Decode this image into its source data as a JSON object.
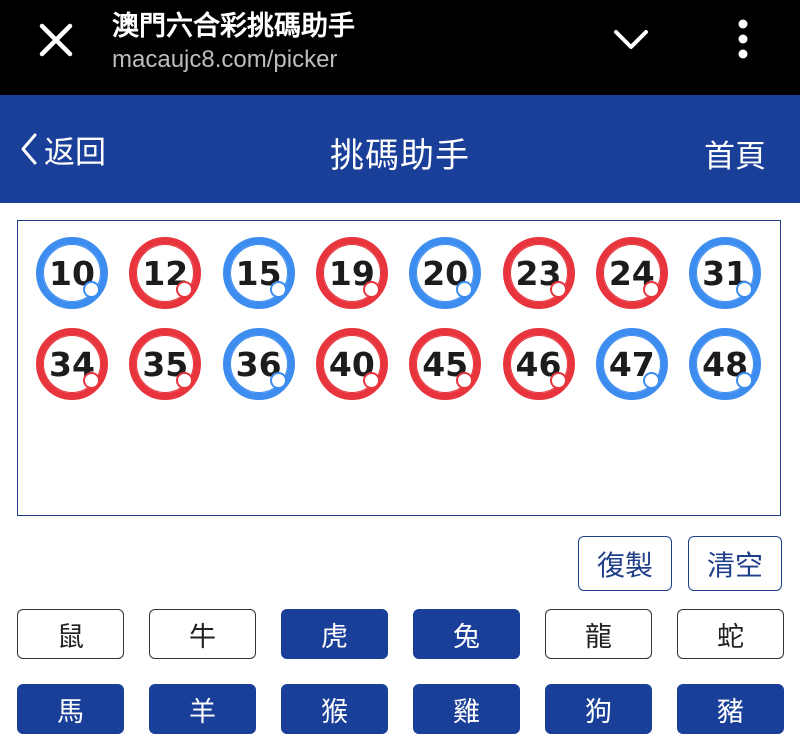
{
  "browser": {
    "title": "澳門六合彩挑碼助手",
    "url": "macaujc8.com/picker"
  },
  "header": {
    "back_label": "返回",
    "title": "挑碼助手",
    "home_label": "首頁"
  },
  "balls": [
    {
      "number": "10",
      "color": "blue"
    },
    {
      "number": "12",
      "color": "red"
    },
    {
      "number": "15",
      "color": "blue"
    },
    {
      "number": "19",
      "color": "red"
    },
    {
      "number": "20",
      "color": "blue"
    },
    {
      "number": "23",
      "color": "red"
    },
    {
      "number": "24",
      "color": "red"
    },
    {
      "number": "31",
      "color": "blue"
    },
    {
      "number": "34",
      "color": "red"
    },
    {
      "number": "35",
      "color": "red"
    },
    {
      "number": "36",
      "color": "blue"
    },
    {
      "number": "40",
      "color": "red"
    },
    {
      "number": "45",
      "color": "red"
    },
    {
      "number": "46",
      "color": "red"
    },
    {
      "number": "47",
      "color": "blue"
    },
    {
      "number": "48",
      "color": "blue"
    }
  ],
  "actions": {
    "copy_label": "復製",
    "clear_label": "清空"
  },
  "zodiac": [
    {
      "label": "鼠",
      "selected": false
    },
    {
      "label": "牛",
      "selected": false
    },
    {
      "label": "虎",
      "selected": true
    },
    {
      "label": "兔",
      "selected": true
    },
    {
      "label": "龍",
      "selected": false
    },
    {
      "label": "蛇",
      "selected": false
    },
    {
      "label": "馬",
      "selected": true
    },
    {
      "label": "羊",
      "selected": true
    },
    {
      "label": "猴",
      "selected": true
    },
    {
      "label": "雞",
      "selected": true
    },
    {
      "label": "狗",
      "selected": true
    },
    {
      "label": "豬",
      "selected": true
    }
  ],
  "colors": {
    "header_bg": "#1a3f98",
    "ball_red": "#e8343c",
    "ball_blue": "#3d8df0"
  }
}
